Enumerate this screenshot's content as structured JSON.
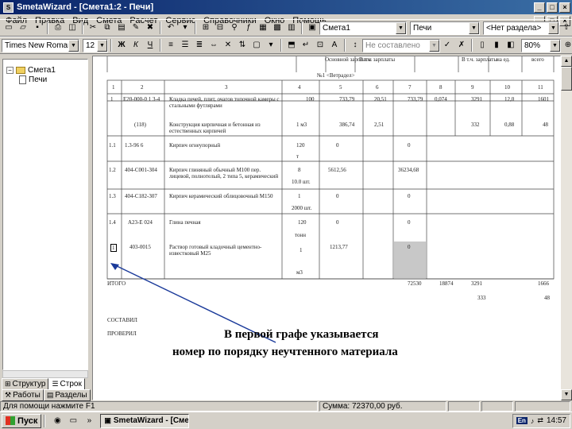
{
  "window": {
    "title": "SmetaWizard - [Смета1:2 - Печи]",
    "minimize": "_",
    "maximize": "□",
    "close": "×"
  },
  "menu": {
    "items": [
      "Файл",
      "Правка",
      "Вид",
      "Смета",
      "Расчет",
      "Сервис",
      "Справочники",
      "Окно",
      "Помощь"
    ]
  },
  "toolbar1": {
    "estimate": "Смета1",
    "section": "Печи",
    "subsection": "<Нет раздела>"
  },
  "toolbar2": {
    "font": "Times New Roman",
    "size": "12",
    "bold": "Ж",
    "italic": "К",
    "underline": "Ч",
    "style": "Не составлено",
    "zoom": "80%"
  },
  "tree": {
    "root": "Смета1",
    "child": "Печи"
  },
  "panel_tabs": {
    "structure": "Структур",
    "rows": "Строк",
    "works": "Работы",
    "sections": "Разделы"
  },
  "sheet": {
    "head_cols": [
      "Основной зарплаты",
      "В т.ч. зарплаты",
      "В т.ч. зарплаты",
      "на ед.",
      "всего"
    ],
    "section_title": "№1 <Ветрадел>",
    "col_numbers": [
      "1",
      "2",
      "3",
      "4",
      "5",
      "6",
      "7",
      "8",
      "9",
      "10",
      "11"
    ],
    "rows": [
      {
        "num": "1",
        "code": "Е20-000-0 1 3-4",
        "name": "Кладка печей, плит, очагов топочной камеры с стальными футлярами",
        "qty": "100",
        "c5": "733,79",
        "c6": "20,51",
        "c7": "733,79",
        "c8": "0,074",
        "c9": "3291",
        "c10": "12,0",
        "c11": "1601"
      },
      {
        "num": "",
        "code": "(118)",
        "name": "Конструкция кирпичная и бетонная из естественных кирпичей",
        "qty": "1 м3",
        "c5": "386,74",
        "c6": "2,51",
        "c7": "",
        "c8": "",
        "c9": "332",
        "c10": "0,88",
        "c11": "48"
      },
      {
        "num": "1.1",
        "code": "1.3-96 6",
        "name": "Кирпич огнеупорный",
        "qty": "120",
        "c5": "0",
        "c6": "",
        "c7": "0",
        "c8": "",
        "c9": "",
        "c10": "",
        "c11": "",
        "extra": "т"
      },
      {
        "num": "1.2",
        "code": "404-С001-304",
        "name": "Кирпич глиняный обычный М100 пер. лицевой, полнотелый, 2 типа 5, керамический",
        "qty": "8",
        "c5": "5612,56",
        "c6": "",
        "c7": "36234,68",
        "c8": "",
        "c9": "",
        "c10": "",
        "c11": "",
        "extra": "10.0 шт."
      },
      {
        "num": "1.3",
        "code": "404-С182-307",
        "name": "Кирпич керамический облицовочный М150",
        "qty": "1",
        "c5": "0",
        "c6": "",
        "c7": "0",
        "c8": "",
        "c9": "",
        "c10": "",
        "c11": "",
        "extra": "2000 шт."
      },
      {
        "num": "1.4",
        "code": "А23-Е 024",
        "name": "Глина печная",
        "qty": "120",
        "c5": "0",
        "c6": "",
        "c7": "0",
        "c8": "",
        "c9": "",
        "c10": "",
        "c11": "",
        "extra": "тонн"
      },
      {
        "num": "1",
        "code": "403-0015",
        "name": "Раствор готовый кладочный цементно-известковый М25",
        "qty": "1",
        "c5": "1213,77",
        "c6": "",
        "c7": "0",
        "c8": "",
        "c9": "",
        "c10": "",
        "c11": "",
        "extra": "м3"
      }
    ],
    "total_label": "ИТОГО",
    "total_values": [
      "72530",
      "18874",
      "3291",
      "1666"
    ],
    "total_extra": [
      "333",
      "48"
    ],
    "composed": "СОСТАВИЛ",
    "checked": "ПРОВЕРИЛ"
  },
  "annotation": {
    "line1": "В первой графе указывается",
    "line2": "номер по порядку неучтенного материала"
  },
  "statusbar": {
    "help": "Для помощи нажмите F1",
    "sum": "Сумма: 72370,00 руб."
  },
  "taskbar": {
    "start": "Пуск",
    "task": "SmetaWizard - [Смет...",
    "clock": "14:57",
    "lang": "En"
  }
}
